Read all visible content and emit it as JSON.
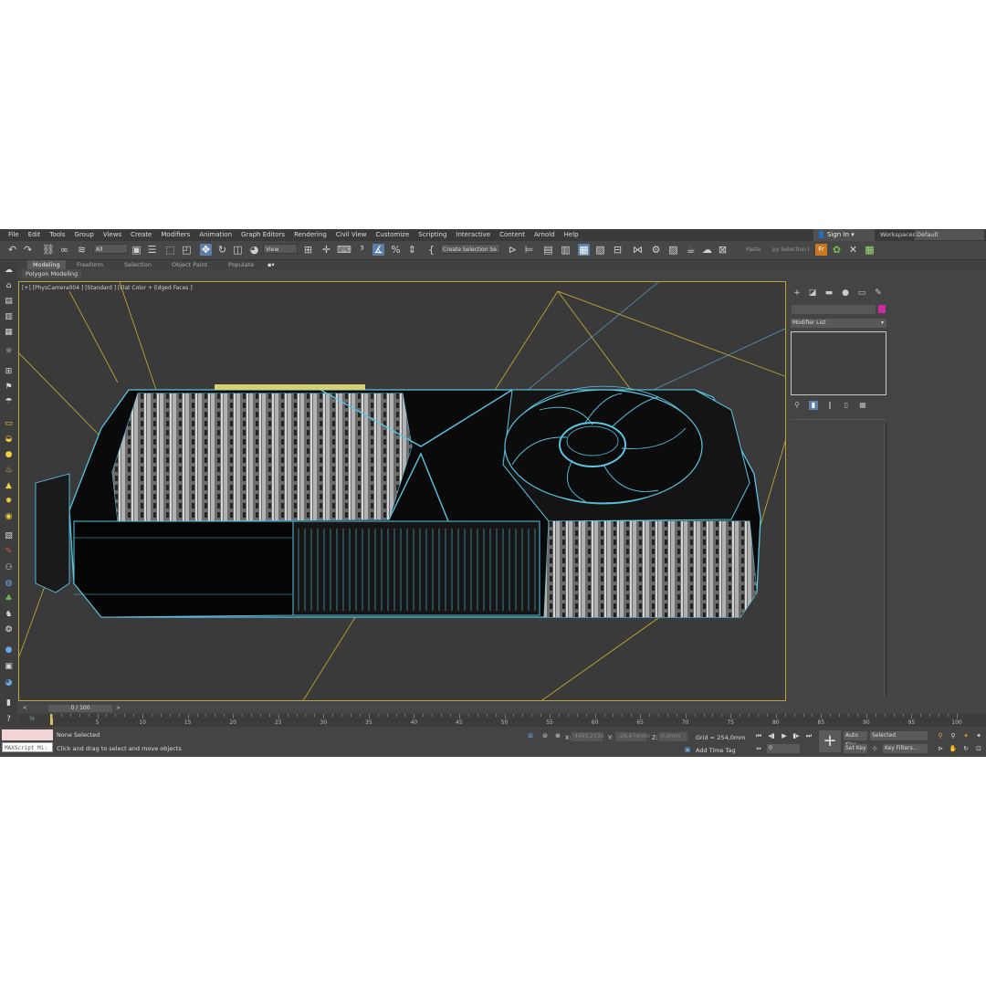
{
  "menu": [
    "File",
    "Edit",
    "Tools",
    "Group",
    "Views",
    "Create",
    "Modifiers",
    "Animation",
    "Graph Editors",
    "Rendering",
    "Civil View",
    "Customize",
    "Scripting",
    "Interactive",
    "Content",
    "Arnold",
    "Help"
  ],
  "account": {
    "sign_in": "Sign In",
    "workspaces_label": "Workspaces:",
    "workspace": "Default"
  },
  "toolbar": {
    "filter": "All",
    "ref_coord": "View",
    "selection_set": "Create Selection Se",
    "paste": "Paste",
    "py_selection": "py Selection I",
    "icons": [
      "undo-icon",
      "redo-icon",
      "link-icon",
      "unlink-icon",
      "bind-space-warp-icon",
      "select-object-icon",
      "select-by-name-icon",
      "rect-region-icon",
      "window-crossing-icon",
      "select-move-icon",
      "select-rotate-icon",
      "select-scale-icon",
      "select-place-icon",
      "pivot-icon",
      "keyboard-shortcut-icon",
      "snap-3d-icon",
      "angle-snap-icon",
      "percent-snap-icon",
      "spinner-snap-icon",
      "edit-named-sets-icon",
      "mirror-icon",
      "align-icon",
      "layer-explorer-icon",
      "ribbon-toggle-icon",
      "curve-editor-icon",
      "schematic-view-icon",
      "material-editor-icon",
      "render-setup-icon",
      "rendered-frame-icon",
      "render-icon",
      "render-cloud-icon",
      "a360-icon",
      "fr-icon",
      "leaf-icon",
      "tool-icon",
      "table-icon"
    ]
  },
  "ribbon": {
    "tabs": [
      "Modeling",
      "Freeform",
      "Selection",
      "Object Paint",
      "Populate"
    ],
    "panel": "Polygon Modeling"
  },
  "viewport": {
    "label": "[+] [PhysCamera004 ] [Standard ] [Flat Color + Edged Faces ]"
  },
  "command_panel": {
    "modifier_list": "Modifier List",
    "object_color": "#cc2aa0"
  },
  "timeline": {
    "slider": "0 / 100",
    "ticks": [
      "5",
      "10",
      "15",
      "20",
      "25",
      "30",
      "35",
      "40",
      "45",
      "50",
      "55",
      "60",
      "65",
      "70",
      "75",
      "80",
      "85",
      "90",
      "95",
      "100"
    ]
  },
  "status": {
    "maxscript": "MAXScript Mi:",
    "selection": "None Selected",
    "prompt": "Click and drag to select and move objects",
    "x_label": "X:",
    "x_value": "4460,253n",
    "y_label": "Y:",
    "y_value": "-26,674mm",
    "z_label": "Z:",
    "z_value": "0,0mm",
    "grid": "Grid = 254,0mm",
    "add_time_tag": "Add Time Tag",
    "auto_key": "Auto Key",
    "key_mode": "Selected",
    "set_key": "Set Key",
    "key_filters": "Key Filters...",
    "frame": "0"
  },
  "colors": {
    "ui_bg": "#444444",
    "viewport_bg": "#3a3a3a",
    "wire": "#5bc4e0",
    "camera_lines": "#c9b230",
    "active_tool": "#5b7fa8"
  }
}
